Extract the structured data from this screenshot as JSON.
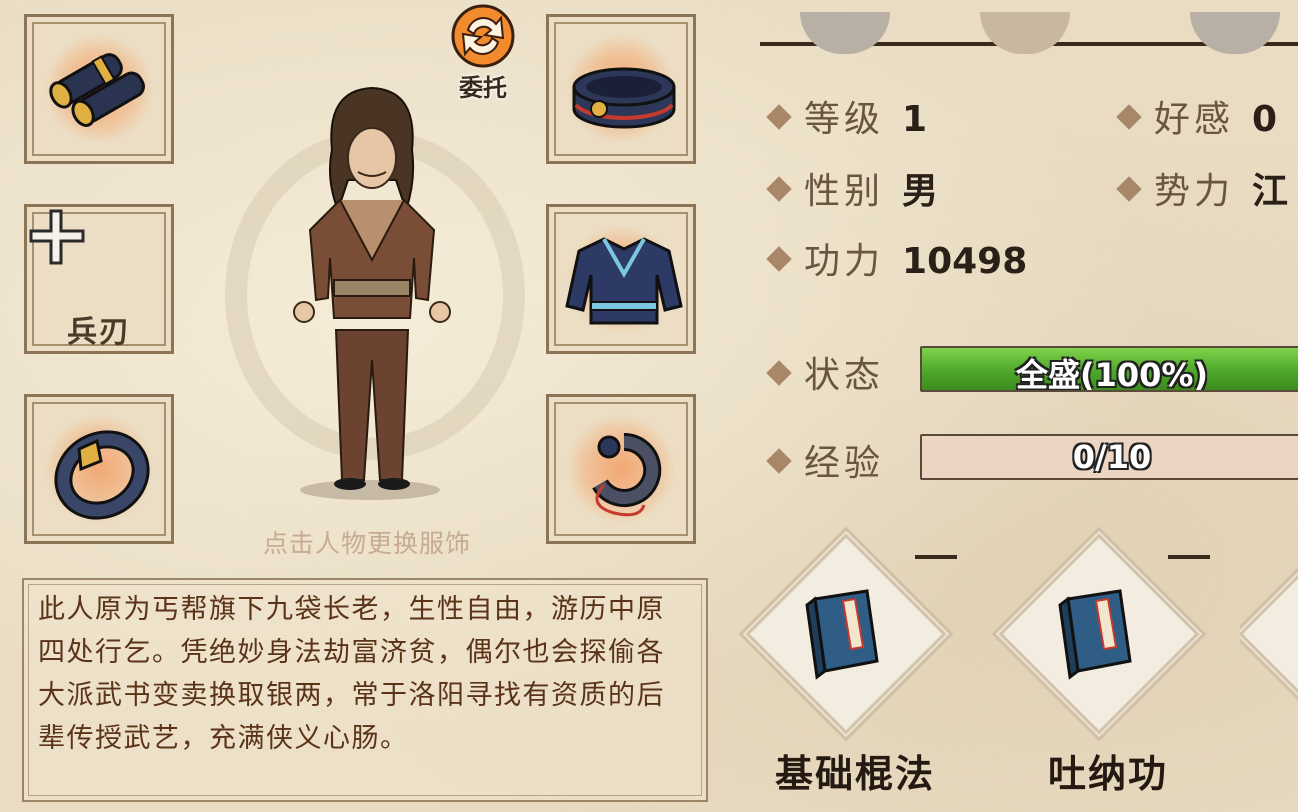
{
  "equipment": {
    "left_slots": [
      {
        "item": "bracers-icon"
      },
      {
        "item": "weapon-empty",
        "label": "兵刃"
      },
      {
        "item": "ring-icon"
      }
    ],
    "right_slots": [
      {
        "item": "belt-icon"
      },
      {
        "item": "robe-icon"
      },
      {
        "item": "amulet-icon"
      }
    ],
    "delegate_label": "委托",
    "hint": "点击人物更换服饰"
  },
  "bio": "此人原为丐帮旗下九袋长老，生性自由，游历中原四处行乞。凭绝妙身法劫富济贫，偶尔也会探偷各大派武书变卖换取银两，常于洛阳寻找有资质的后辈传授武艺，充满侠义心肠。",
  "stats": {
    "level_label": "等级",
    "level_value": "1",
    "favor_label": "好感",
    "favor_value": "0",
    "gender_label": "性别",
    "gender_value": "男",
    "faction_label": "势力",
    "faction_value": "江",
    "power_label": "功力",
    "power_value": "10498",
    "status_label": "状态",
    "status_text": "全盛(100%)",
    "status_fill": 1.0,
    "exp_label": "经验",
    "exp_text": "0/10",
    "exp_fill": 0.0
  },
  "skills": [
    {
      "name": "基础棍法",
      "level": "一"
    },
    {
      "name": "吐纳功",
      "level": "一"
    },
    {
      "name": "",
      "level": ""
    }
  ],
  "colors": {
    "status_green": "#4ea82a",
    "accent_diamond": "#a88769",
    "text_brown": "#5a3318"
  }
}
